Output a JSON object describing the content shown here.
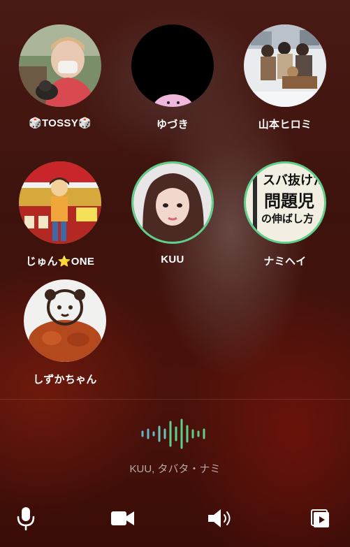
{
  "participants": [
    {
      "name": "🎲TOSSY🎲",
      "speaking": false
    },
    {
      "name": "ゆづき",
      "speaking": false
    },
    {
      "name": "山本ヒロミ",
      "speaking": false
    },
    {
      "name": "じゅん⭐ONE",
      "speaking": false
    },
    {
      "name": "KUU",
      "speaking": true
    },
    {
      "name": "ナミヘイ",
      "speaking": true,
      "avatar_text": [
        "スバ抜けた",
        "問題児",
        "の伸ばし方"
      ]
    },
    {
      "name": "しずかちゃん",
      "speaking": false
    }
  ],
  "status": {
    "speakers": "KUU, タバタ・ナミ"
  },
  "controls": {
    "mic": "microphone-icon",
    "video": "video-camera-icon",
    "speaker": "speaker-icon",
    "share": "screen-share-icon"
  },
  "colors": {
    "speaking_ring": "#5fcf8a",
    "wave_green": "#5fcf8a",
    "wave_teal": "#63b7c9"
  }
}
